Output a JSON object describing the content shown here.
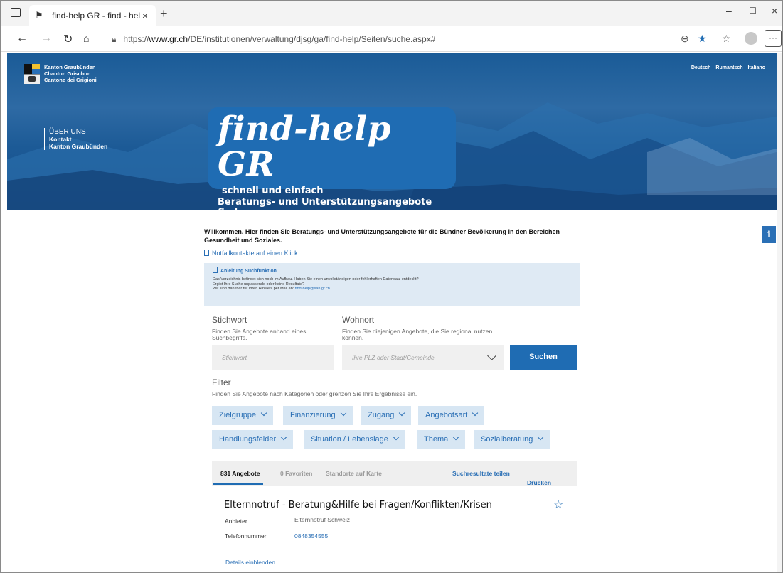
{
  "browser": {
    "tab_title": "find-help GR - find - help",
    "url_prefix": "https://",
    "url_host": "www.gr.ch",
    "url_path": "/DE/institutionen/verwaltung/djsg/ga/find-help/Seiten/suche.aspx#"
  },
  "header": {
    "logo_lines": [
      "Kanton Graubünden",
      "Chantun Grischun",
      "Cantone dei Grigioni"
    ],
    "languages": [
      "Deutsch",
      "Rumantsch",
      "Italiano"
    ],
    "nav": {
      "about": "ÜBER UNS",
      "contact": "Kontakt",
      "canton": "Kanton Graubünden"
    },
    "brand": {
      "title": "find-help GR",
      "sub1": "schnell und einfach",
      "sub2": "Beratungs- und Unterstützungsangebote finden"
    }
  },
  "main": {
    "welcome": "Willkommen. Hier finden Sie Beratungs- und Unterstützungsangebote für die Bündner Bevölkerung in den Bereichen Gesundheit und Soziales.",
    "notfall_link": "Notfallkontakte auf einen Klick",
    "info": {
      "title": "Anleitung Suchfunktion",
      "line1": "Das Verzeichnis befindet sich noch im Aufbau. Haben Sie einen unvollständigen oder fehlerhaften Datensatz entdeckt?",
      "line2": "Ergibt Ihre Suche unpassende oder keine Resultate?",
      "line3": "Wir sind dankbar für Ihren Hinweis per Mail an: ",
      "email": "find-help@san.gr.ch"
    },
    "search": {
      "keyword_label": "Stichwort",
      "keyword_hint": "Finden Sie Angebote anhand eines Suchbegriffs.",
      "keyword_placeholder": "Stichwort",
      "location_label": "Wohnort",
      "location_hint": "Finden Sie diejenigen Angebote, die Sie regional nutzen können.",
      "location_placeholder": "Ihre PLZ oder Stadt/Gemeinde",
      "button": "Suchen"
    },
    "filter": {
      "label": "Filter",
      "hint": "Finden Sie Angebote nach Kategorien oder grenzen Sie Ihre Ergebnisse ein.",
      "chips": [
        "Zielgruppe",
        "Finanzierung",
        "Zugang",
        "Angebotsart",
        "Handlungsfelder",
        "Situation / Lebenslage",
        "Thema",
        "Sozialberatung"
      ]
    },
    "results_tabs": {
      "offers": "831 Angebote",
      "favorites": "0 Favoriten",
      "map": "Standorte auf Karte",
      "share": "Suchresultate teilen",
      "print": "Drucken"
    },
    "result": {
      "title": "Elternnotruf - Beratung&Hilfe bei Fragen/Konflikten/Krisen",
      "provider_label": "Anbieter",
      "provider": "Elternnotruf Schweiz",
      "phone_label": "Telefonnummer",
      "phone": "0848354555",
      "details": "Details einblenden"
    }
  },
  "colors": {
    "brand": "#1f6cb3",
    "chip_bg": "#d7e6f3",
    "infobox_bg": "#dfeaf4"
  }
}
